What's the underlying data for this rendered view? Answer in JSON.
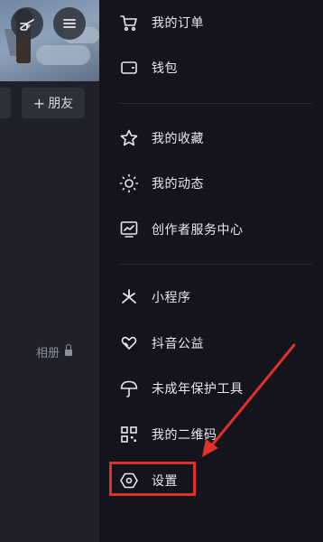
{
  "left_panel": {
    "add_friend_label": "朋友",
    "add_friend_prefix": "+",
    "album_label": "相册"
  },
  "menu": {
    "items": [
      {
        "label": "我的订单",
        "icon": "cart-icon"
      },
      {
        "label": "钱包",
        "icon": "wallet-icon"
      },
      {
        "label": "我的收藏",
        "icon": "star-icon"
      },
      {
        "label": "我的动态",
        "icon": "sun-icon"
      },
      {
        "label": "创作者服务中心",
        "icon": "chart-monitor-icon"
      },
      {
        "label": "小程序",
        "icon": "asterisk-icon"
      },
      {
        "label": "抖音公益",
        "icon": "heart-hands-icon"
      },
      {
        "label": "未成年保护工具",
        "icon": "umbrella-icon"
      },
      {
        "label": "我的二维码",
        "icon": "qrcode-icon"
      },
      {
        "label": "设置",
        "icon": "settings-hexagon-icon"
      }
    ]
  },
  "annotation": {
    "highlight_color": "#e0302a"
  }
}
